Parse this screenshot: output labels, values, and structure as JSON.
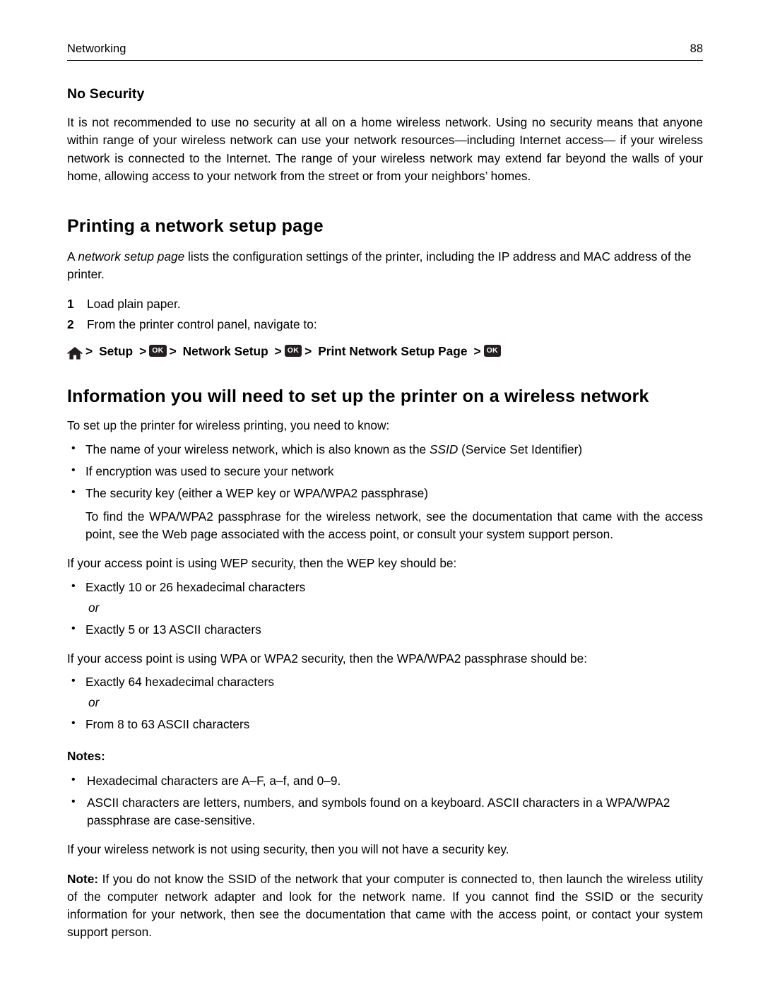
{
  "header": {
    "title": "Networking",
    "page_number": "88"
  },
  "sections": {
    "no_security": {
      "heading": "No Security",
      "paragraph": "It is not recommended to use no security at all on a home wireless network. Using no security means that anyone within range of your wireless network can use your network resources—including Internet access— if your wireless network is connected to the Internet. The range of your wireless network may extend far beyond the walls of your home, allowing access to your network from the street or from your neighbors’ homes."
    },
    "printing_setup_page": {
      "heading": "Printing a network setup page",
      "intro_pre": "A ",
      "intro_italic": "network setup page",
      "intro_post": " lists the configuration settings of the printer, including the IP address and MAC address of the printer.",
      "steps": [
        {
          "num": "1",
          "text": "Load plain paper."
        },
        {
          "num": "2",
          "text": "From the printer control panel, navigate to:"
        }
      ],
      "nav_path": {
        "home_icon": "home-icon",
        "sep": ">",
        "setup": "Setup",
        "ok1": "OK",
        "network_setup": "Network Setup",
        "ok2": "OK",
        "print_network_setup_page": "Print Network Setup Page",
        "ok3": "OK"
      }
    },
    "wireless_info": {
      "heading": "Information you will need to set up the printer on a wireless network",
      "intro": "To set up the printer for wireless printing, you need to know:",
      "bullets_1": [
        {
          "pre": "The name of your wireless network, which is also known as the ",
          "italic": "SSID",
          "post": " (Service Set Identifier)"
        },
        {
          "pre": "If encryption was used to secure your network",
          "italic": "",
          "post": ""
        },
        {
          "pre": "The security key (either a WEP key or WPA/WPA2 passphrase)",
          "italic": "",
          "post": ""
        }
      ],
      "sub_paragraph": "To find the WPA/WPA2 passphrase for the wireless network, see the documentation that came with the access point, see the Web page associated with the access point, or consult your system support person.",
      "wep_intro": "If your access point is using WEP security, then the WEP key should be:",
      "wep_bullets": [
        "Exactly 10 or 26 hexadecimal characters",
        "Exactly 5 or 13 ASCII characters"
      ],
      "or_label": "or",
      "wpa_intro": "If your access point is using WPA or WPA2 security, then the WPA/WPA2 passphrase should be:",
      "wpa_bullets": [
        "Exactly 64 hexadecimal characters",
        "From 8 to 63 ASCII characters"
      ],
      "notes_heading": "Notes:",
      "notes": [
        "Hexadecimal characters are A–F, a–f, and 0–9.",
        "ASCII characters are letters, numbers, and symbols found on a keyboard. ASCII characters in a WPA/WPA2 passphrase are case-sensitive."
      ],
      "no_security_note": "If your wireless network is not using security, then you will not have a security key.",
      "final_note_label": "Note:",
      "final_note_text": " If you do not know the SSID of the network that your computer is connected to, then launch the wireless utility of the computer network adapter and look for the network name. If you cannot find the SSID or the security information for your network, then see the documentation that came with the access point, or contact your system support person."
    }
  },
  "bullet_glyph": "•"
}
